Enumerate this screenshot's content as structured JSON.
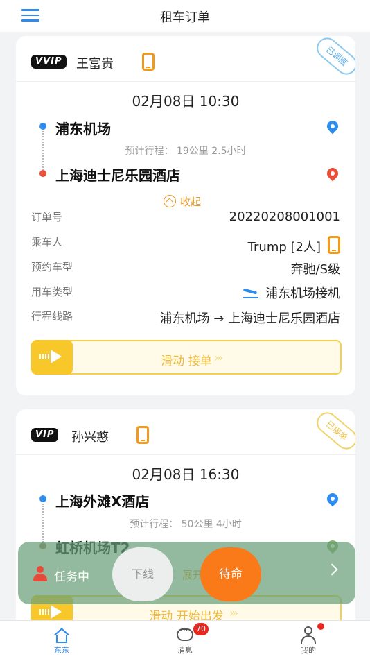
{
  "header": {
    "title": "租车订单"
  },
  "orders": [
    {
      "vip_badge": "VVIP",
      "customer": "王富贵",
      "status_stamp": "已调度",
      "datetime": "02月08日 10:30",
      "from": "浦东机场",
      "trip_estimate": "预计行程：  19公里 2.5小时",
      "to": "上海迪士尼乐园酒店",
      "collapse_label": "收起",
      "details": {
        "order_no_label": "订单号",
        "order_no": "20220208001001",
        "passenger_label": "乘车人",
        "passenger": "Trump [2人]",
        "car_model_label": "预约车型",
        "car_model": "奔驰/S级",
        "use_type_label": "用车类型",
        "use_type": "浦东机场接机",
        "route_label": "行程线路",
        "route": "浦东机场 → 上海迪士尼乐园酒店"
      },
      "slide_action": "滑动 接单"
    },
    {
      "vip_badge": "VIP",
      "customer": "孙兴憨",
      "status_stamp": "已接单",
      "datetime": "02月08日 16:30",
      "from": "上海外滩X酒店",
      "trip_estimate": "预计行程：  50公里 4小时",
      "to": "虹桥机场T2",
      "expand_label": "展开",
      "slide_action": "滑动 开始出发"
    }
  ],
  "task_bar": {
    "status_label": "任务中",
    "offline_button": "下线",
    "standby_button": "待命"
  },
  "tabbar": {
    "tabs": [
      {
        "label": "东东",
        "active": true
      },
      {
        "label": "消息",
        "badge": "70"
      },
      {
        "label": "我的",
        "dot": true
      }
    ]
  },
  "colors": {
    "accent": "#2d8cf0",
    "warning": "#f29a1c",
    "standby": "#fa7a1a"
  }
}
